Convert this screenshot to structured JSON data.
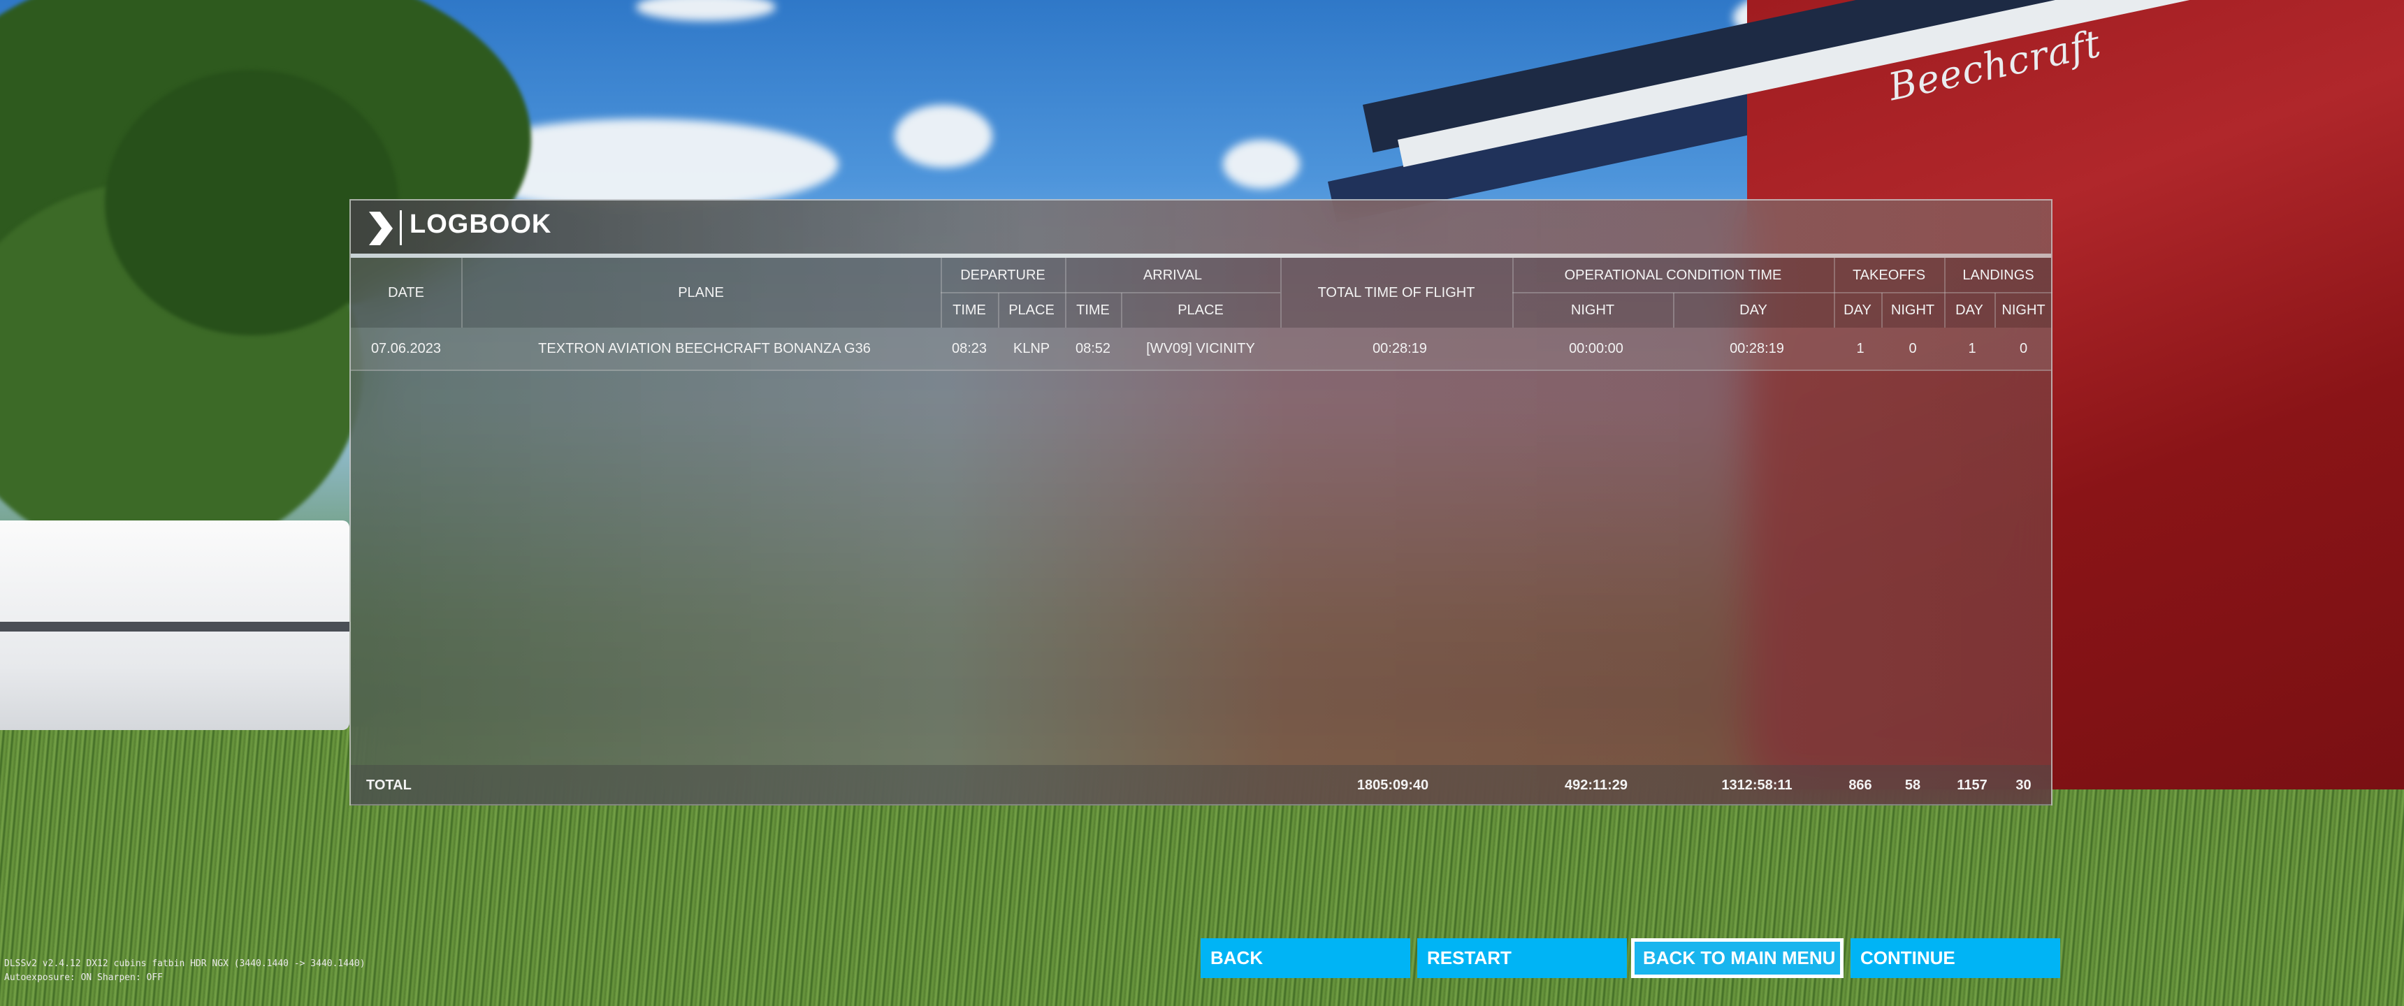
{
  "background": {
    "aircraft_brand": "Beechcraft"
  },
  "logbook": {
    "title": "LOGBOOK",
    "headers": {
      "date": "DATE",
      "plane": "PLANE",
      "departure": "DEPARTURE",
      "arrival": "ARRIVAL",
      "total_time": "TOTAL TIME OF FLIGHT",
      "operational": "OPERATIONAL CONDITION TIME",
      "takeoffs": "TAKEOFFS",
      "landings": "LANDINGS",
      "dep_time": "TIME",
      "dep_place": "PLACE",
      "arr_time": "TIME",
      "arr_place": "PLACE",
      "op_night": "NIGHT",
      "op_day": "DAY",
      "to_day": "DAY",
      "to_night": "NIGHT",
      "ld_day": "DAY",
      "ld_night": "NIGHT"
    },
    "rows": [
      {
        "date": "07.06.2023",
        "plane": "TEXTRON AVIATION BEECHCRAFT BONANZA G36",
        "dep_time": "08:23",
        "dep_place": "KLNP",
        "arr_time": "08:52",
        "arr_place": "[WV09] VICINITY",
        "total_time": "00:28:19",
        "op_night": "00:00:00",
        "op_day": "00:28:19",
        "to_day": "1",
        "to_night": "0",
        "ld_day": "1",
        "ld_night": "0"
      }
    ],
    "total": {
      "label": "TOTAL",
      "total_time": "1805:09:40",
      "op_night": "492:11:29",
      "op_day": "1312:58:11",
      "to_day": "866",
      "to_night": "58",
      "ld_day": "1157",
      "ld_night": "30"
    }
  },
  "buttons": {
    "back": "BACK",
    "restart": "RESTART",
    "main_menu": "BACK TO MAIN MENU",
    "continue": "CONTINUE",
    "focused": "main_menu"
  },
  "debug": {
    "line1": "DLSSv2 v2.4.12 DX12 cubins fatbin HDR NGX (3440.1440 -> 3440.1440)",
    "line2": "Autoexposure: ON Sharpen: OFF"
  },
  "colors": {
    "button_bg": "#00b4f5",
    "fuselage_red": "#a01c20"
  }
}
